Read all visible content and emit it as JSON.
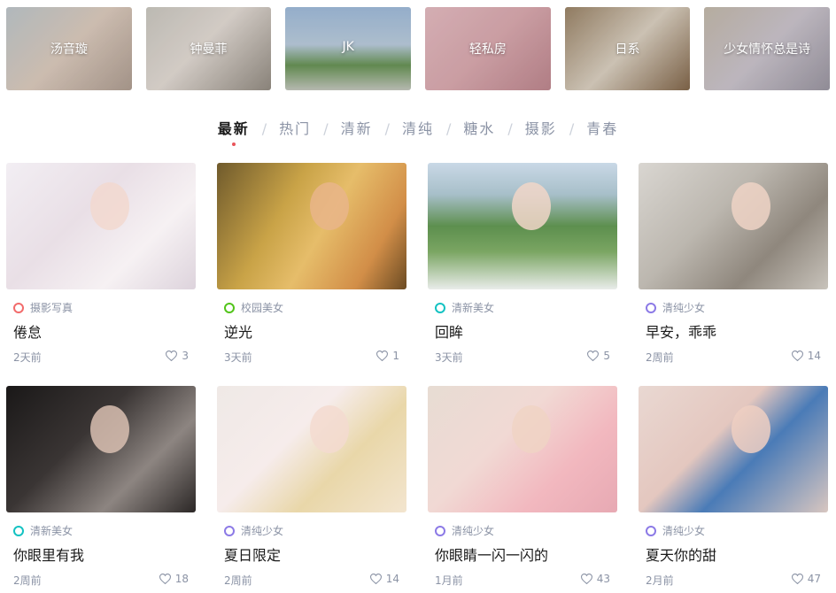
{
  "topics": [
    {
      "label": "汤音璇",
      "bg": "linear-gradient(135deg,#c9d2d6 0%,#e8d6c8 50%,#b9a79a 100%)"
    },
    {
      "label": "钟曼菲",
      "bg": "linear-gradient(135deg,#d6d3cb 0%,#efe7e0 45%,#9c948a 100%)"
    },
    {
      "label": "JK",
      "bg": "linear-gradient(180deg,#a9c6e6 0%,#c5d8ea 45%,#6f9c5b 70%,#cfd3c9 100%)"
    },
    {
      "label": "轻私房",
      "bg": "linear-gradient(135deg,#f1c6cc 0%,#e6b3b9 50%,#c98f97 100%)"
    },
    {
      "label": "日系",
      "bg": "linear-gradient(135deg,#a48c6e 0%,#e7dccc 50%,#8a6d4f 100%)"
    },
    {
      "label": "少女情怀总是诗",
      "bg": "linear-gradient(135deg,#cfc4b5 0%,#d6cfd8 50%,#a49fab 100%)"
    }
  ],
  "tabs": [
    "最新",
    "热门",
    "清新",
    "清纯",
    "糖水",
    "摄影",
    "青春"
  ],
  "tab_separator": "/",
  "posts": [
    {
      "category": "摄影写真",
      "ring": "#f26b6b",
      "title": "倦怠",
      "time": "2天前",
      "likes": "3",
      "bg": "linear-gradient(135deg,#f2eef3 0%,#e9dfe6 40%,#f6f1f3 70%,#ddd3dc 100%)",
      "skin": "#f2d8cf"
    },
    {
      "category": "校园美女",
      "ring": "#52c41a",
      "title": "逆光",
      "time": "3天前",
      "likes": "1",
      "bg": "linear-gradient(120deg,#6f5a2c 0%,#c9a347 35%,#e6bd6a 55%,#d28e48 80%,#6b4b23 100%)",
      "skin": "#e9b58a"
    },
    {
      "category": "清新美女",
      "ring": "#13c2c2",
      "title": "回眸",
      "time": "3天前",
      "likes": "5",
      "bg": "linear-gradient(180deg,#c9d8e6 0%,#a7bfc9 25%,#5d8f4e 50%,#7aa562 70%,#e9ecea 100%)",
      "skin": "#f1d6c8"
    },
    {
      "category": "清纯少女",
      "ring": "#8c7ae6",
      "title": "早安，乖乖",
      "time": "2周前",
      "likes": "14",
      "bg": "linear-gradient(135deg,#d9d6d1 0%,#bcb7af 40%,#8f877d 70%,#c8c3bb 100%)",
      "skin": "#efd4c6"
    },
    {
      "category": "清新美女",
      "ring": "#13c2c2",
      "title": "你眼里有我",
      "time": "2周前",
      "likes": "18",
      "bg": "linear-gradient(135deg,#1a1818 0%,#3a3534 40%,#8d8581 70%,#2b2726 100%)",
      "skin": "#d9bfb1"
    },
    {
      "category": "清纯少女",
      "ring": "#8c7ae6",
      "title": "夏日限定",
      "time": "2周前",
      "likes": "14",
      "bg": "linear-gradient(135deg,#efe9e6 0%,#f6eceb 40%,#e9d7a9 65%,#f3e5cf 100%)",
      "skin": "#f3dbd0"
    },
    {
      "category": "清纯少女",
      "ring": "#8c7ae6",
      "title": "你眼睛一闪一闪的",
      "time": "1月前",
      "likes": "43",
      "bg": "linear-gradient(135deg,#e7dcd3 0%,#f1d9d4 40%,#f2b8bf 70%,#e7a9b3 100%)",
      "skin": "#f0d3c4"
    },
    {
      "category": "清纯少女",
      "ring": "#8c7ae6",
      "title": "夏天你的甜",
      "time": "2月前",
      "likes": "47",
      "bg": "linear-gradient(135deg,#e9d8d2 0%,#e4c7bf 40%,#4a7bb7 60%,#d8c6c0 100%)",
      "skin": "#efcfc2"
    }
  ]
}
